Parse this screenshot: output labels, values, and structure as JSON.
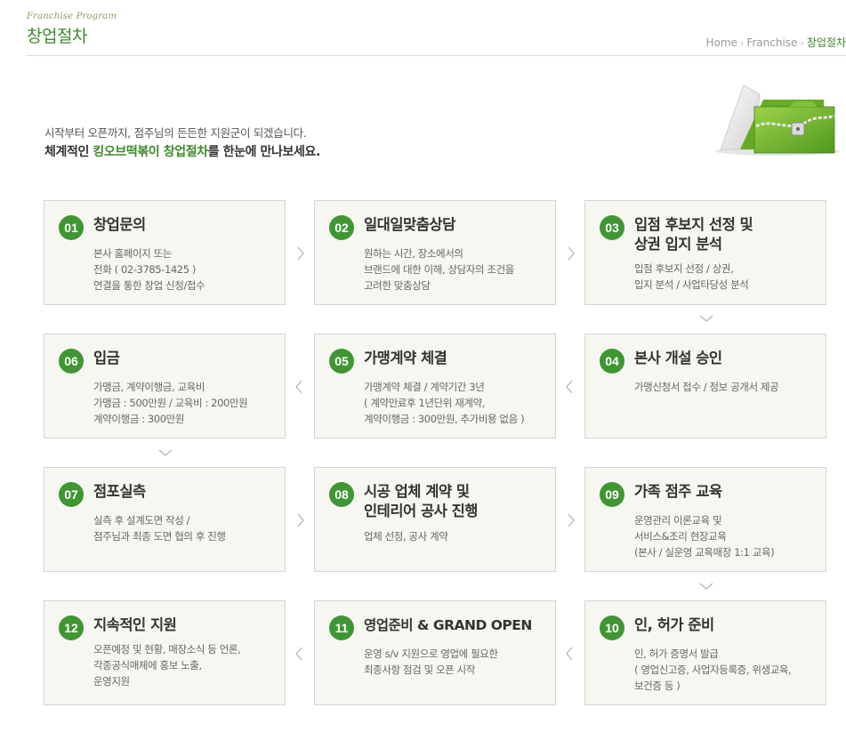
{
  "header": {
    "sub_title": "Franchise Program",
    "title": "창업절차",
    "breadcrumb": [
      {
        "label": "Home"
      },
      {
        "label": "Franchise"
      },
      {
        "label": "창업절차"
      }
    ],
    "separator": "›"
  },
  "intro": {
    "line1": "시작부터 오픈까지, 점주님의 든든한 지원군이 되겠습니다.",
    "line2_prefix": "체계적인 ",
    "line2_highlight": "킹오브떡볶이 창업절차",
    "line2_suffix": "를 한눈에 만나보세요."
  },
  "colors": {
    "accent": "#3f9633",
    "title_green": "#3c8a2a",
    "card_bg": "#f7f7f1",
    "card_border": "#d5d5d5"
  },
  "steps": [
    {
      "num": "01",
      "title": "창업문의",
      "desc": "본사 홈페이지 또는\n전화 ( 02-3785-1425 )\n연결을 통한 창업 신청/접수"
    },
    {
      "num": "02",
      "title": "일대일맞춤상담",
      "desc": "원하는 시간, 장소에서의\n브랜드에 대한 이해, 상담자의 조건을\n고려한 맞춤상담"
    },
    {
      "num": "03",
      "title": "입점 후보지 선정 및\n상권 입지 분석",
      "desc": "입점 후보지 선정 / 상권,\n입지 분석 / 사업타당성 분석"
    },
    {
      "num": "04",
      "title": "본사 개설 승인",
      "desc": "가맹신청서 접수 / 정보 공개서 제공"
    },
    {
      "num": "05",
      "title": "가맹계약 체결",
      "desc": "가맹계약 체결 / 계약기간 3년\n( 계약만료후 1년단위 재계약,\n계약이행금 : 300만원, 추가비용 없음 )"
    },
    {
      "num": "06",
      "title": "입금",
      "desc": "가맹금, 계약이행금, 교육비\n가맹금 : 500만원 / 교육비 : 200만원\n계약이행금 : 300만원"
    },
    {
      "num": "07",
      "title": "점포실측",
      "desc": "실측 후 설계도면 작성 /\n점주님과 최종 도면 협의 후 진행"
    },
    {
      "num": "08",
      "title": "시공 업체 계약 및\n인테리어 공사 진행",
      "desc": "업체 선정, 공사 계약"
    },
    {
      "num": "09",
      "title": "가족 점주 교육",
      "desc": "운영관리 이론교육 및\n서비스&조리 현장교육\n(본사 / 실운영 교육매장 1:1 교육)"
    },
    {
      "num": "10",
      "title": "인, 허가 준비",
      "desc": "인, 허가 증명서 발급\n( 영업신고증, 사업자등록증, 위생교육,\n보건증 등 )"
    },
    {
      "num": "11",
      "title": "영업준비 & GRAND OPEN",
      "desc": "운영 s/v 지원으로 영업에 필요한\n최종사항 점검 및 오픈 시작"
    },
    {
      "num": "12",
      "title": "지속적인 지원",
      "desc": "오픈예정 및 현황, 매장소식 등 언론,\n각종공식매체에 홍보 노출,\n운영지원"
    }
  ]
}
